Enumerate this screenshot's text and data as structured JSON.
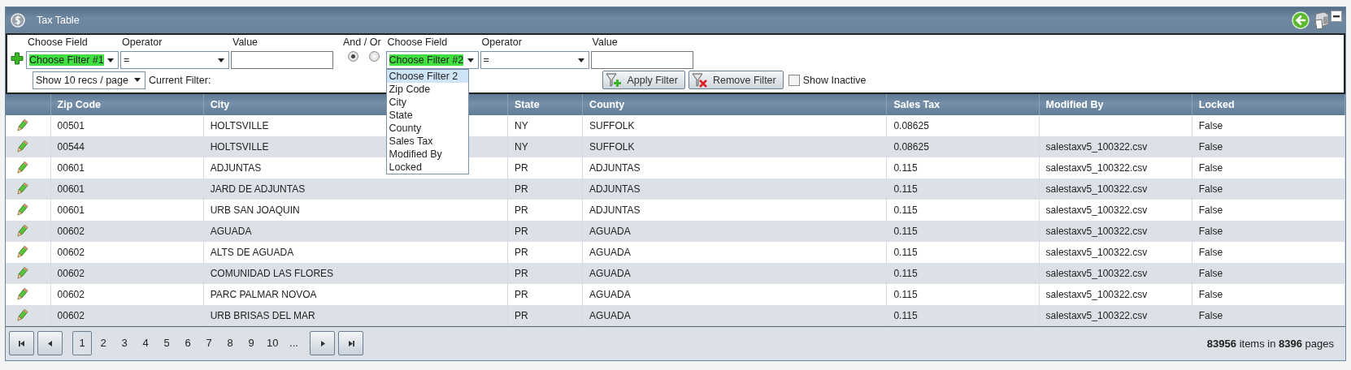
{
  "window": {
    "title": "Tax Table"
  },
  "filter": {
    "groups": [
      {
        "field_label": "Choose Field",
        "field": {
          "value": "Choose Filter #1",
          "highlighted": true
        },
        "operator_label": "Operator",
        "operator": "=",
        "value_label": "Value"
      },
      {
        "field_label": "Choose Field",
        "field": {
          "value": "Choose Filter #2",
          "highlighted": true,
          "expanded": true
        },
        "operator_label": "Operator",
        "operator": "=",
        "value_label": "Value"
      }
    ],
    "and_or": {
      "label": "And / Or",
      "options": [
        {
          "selected": true
        },
        {
          "selected": false
        }
      ]
    },
    "dropdown": {
      "items": [
        {
          "label": "Choose Filter 2",
          "selected": true
        },
        {
          "label": "Zip Code",
          "selected": false
        },
        {
          "label": "City",
          "selected": false
        },
        {
          "label": "State",
          "selected": false
        },
        {
          "label": "County",
          "selected": false
        },
        {
          "label": "Sales Tax",
          "selected": false
        },
        {
          "label": "Modified By",
          "selected": false
        },
        {
          "label": "Locked",
          "selected": false
        }
      ]
    },
    "page_size": "Show 10 recs / page",
    "current_filter_label": "Current Filter:",
    "buttons": [
      {
        "kind": "apply",
        "label": "Apply Filter"
      },
      {
        "kind": "remove",
        "label": "Remove Filter"
      }
    ],
    "show_inactive": {
      "label": "Show Inactive",
      "checked": false
    }
  },
  "table": {
    "columns": [
      {
        "kind": "edit"
      },
      {
        "label": "Zip Code"
      },
      {
        "label": "City"
      },
      {
        "label": "State"
      },
      {
        "label": "County"
      },
      {
        "label": "Sales Tax"
      },
      {
        "label": "Modified By"
      },
      {
        "label": "Locked"
      }
    ],
    "rows": [
      [
        "",
        "00501",
        "HOLTSVILLE",
        "NY",
        "SUFFOLK",
        "0.08625",
        "",
        "False"
      ],
      [
        "",
        "00544",
        "HOLTSVILLE",
        "NY",
        "SUFFOLK",
        "0.08625",
        "salestaxv5_100322.csv",
        "False"
      ],
      [
        "",
        "00601",
        "ADJUNTAS",
        "PR",
        "ADJUNTAS",
        "0.115",
        "salestaxv5_100322.csv",
        "False"
      ],
      [
        "",
        "00601",
        "JARD DE ADJUNTAS",
        "PR",
        "ADJUNTAS",
        "0.115",
        "salestaxv5_100322.csv",
        "False"
      ],
      [
        "",
        "00601",
        "URB SAN JOAQUIN",
        "PR",
        "ADJUNTAS",
        "0.115",
        "salestaxv5_100322.csv",
        "False"
      ],
      [
        "",
        "00602",
        "AGUADA",
        "PR",
        "AGUADA",
        "0.115",
        "salestaxv5_100322.csv",
        "False"
      ],
      [
        "",
        "00602",
        "ALTS DE AGUADA",
        "PR",
        "AGUADA",
        "0.115",
        "salestaxv5_100322.csv",
        "False"
      ],
      [
        "",
        "00602",
        "COMUNIDAD LAS FLORES",
        "PR",
        "AGUADA",
        "0.115",
        "salestaxv5_100322.csv",
        "False"
      ],
      [
        "",
        "00602",
        "PARC PALMAR NOVOA",
        "PR",
        "AGUADA",
        "0.115",
        "salestaxv5_100322.csv",
        "False"
      ],
      [
        "",
        "00602",
        "URB BRISAS DEL MAR",
        "PR",
        "AGUADA",
        "0.115",
        "salestaxv5_100322.csv",
        "False"
      ]
    ]
  },
  "pager": {
    "pages": [
      {
        "label": "1",
        "selected": true
      },
      {
        "label": "2",
        "selected": false
      },
      {
        "label": "3",
        "selected": false
      },
      {
        "label": "4",
        "selected": false
      },
      {
        "label": "5",
        "selected": false
      },
      {
        "label": "6",
        "selected": false
      },
      {
        "label": "7",
        "selected": false
      },
      {
        "label": "8",
        "selected": false
      },
      {
        "label": "9",
        "selected": false
      },
      {
        "label": "10",
        "selected": false
      }
    ],
    "more": "...",
    "summary": "**83956** items in **8396** pages"
  }
}
